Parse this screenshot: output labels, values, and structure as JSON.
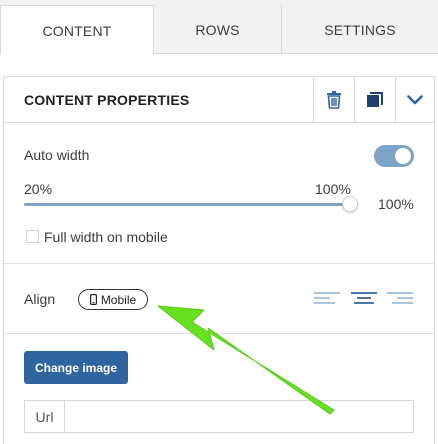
{
  "tabs": [
    {
      "label": "CONTENT",
      "active": true
    },
    {
      "label": "ROWS",
      "active": false
    },
    {
      "label": "SETTINGS",
      "active": false
    }
  ],
  "panel": {
    "title": "CONTENT PROPERTIES",
    "actions": [
      "trash-icon",
      "duplicate-icon",
      "chevron-down-icon"
    ]
  },
  "auto_width": {
    "label": "Auto width",
    "enabled": true,
    "min_label": "20%",
    "max_label": "100%",
    "value_label": "100%",
    "value_fraction": 1.0
  },
  "full_width_mobile": {
    "label": "Full width on mobile",
    "checked": false
  },
  "align": {
    "label": "Align",
    "mobile_label": "Mobile",
    "selected": "center",
    "options": [
      "left",
      "center",
      "right"
    ]
  },
  "image": {
    "change_label": "Change image",
    "url_label": "Url",
    "url_value": ""
  },
  "colors": {
    "accent": "#2f64a1",
    "toggle": "#7ea3c9",
    "arrow": "#66e01f"
  }
}
